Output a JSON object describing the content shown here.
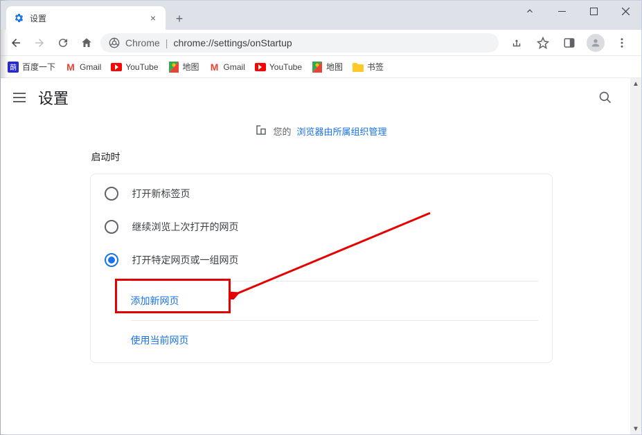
{
  "tab": {
    "title": "设置"
  },
  "omnibox": {
    "site_label": "Chrome",
    "url": "chrome://settings/onStartup"
  },
  "bookmarks": [
    {
      "label": "百度一下",
      "icon": "baidu"
    },
    {
      "label": "Gmail",
      "icon": "gmail"
    },
    {
      "label": "YouTube",
      "icon": "youtube"
    },
    {
      "label": "地图",
      "icon": "maps"
    },
    {
      "label": "Gmail",
      "icon": "gmail"
    },
    {
      "label": "YouTube",
      "icon": "youtube"
    },
    {
      "label": "地图",
      "icon": "maps"
    },
    {
      "label": "书签",
      "icon": "folder"
    }
  ],
  "settings": {
    "title": "设置",
    "managed_prefix": "您的",
    "managed_link": "浏览器由所属组织管理",
    "section_title": "启动时",
    "options": {
      "new_tab": "打开新标签页",
      "continue": "继续浏览上次打开的网页",
      "specific": "打开特定网页或一组网页"
    },
    "actions": {
      "add_page": "添加新网页",
      "use_current": "使用当前网页"
    }
  }
}
